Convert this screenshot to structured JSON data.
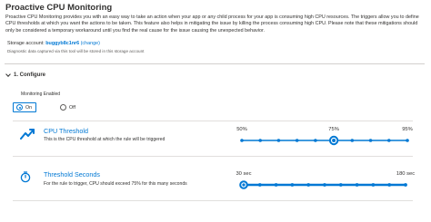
{
  "page": {
    "title": "Proactive CPU Monitoring",
    "description": "Proactive CPU Monitoring provides you with an easy way to take an action when your app or any child process for your app is consuming high CPU resources. The triggers allow you to define CPU thresholds at which you want the actions to be taken. This feature also helps in mitigating the issue by killing the process consuming high CPU. Please note that these mitigations should only be considered a temporary workaround until you find the real cause for the issue causing the unexpected behavior."
  },
  "storage": {
    "label": "Storage account:",
    "account": "buggyb8c1nr6",
    "change_link": "(change)",
    "note": "Diagnostic data captured via this tool will be stored in this storage account"
  },
  "configure": {
    "section_label": "1. Configure",
    "monitoring_label": "Monitoring Enabled",
    "options": [
      "On",
      "Off"
    ],
    "selected": "On"
  },
  "cpu_threshold": {
    "icon": "line-chart-icon",
    "title": "CPU Threshold",
    "subtitle": "This is the CPU threshold at which the rule will be triggered",
    "labels": [
      "50%",
      "75%",
      "95%"
    ],
    "label_values": [
      50,
      75,
      95
    ],
    "min": 50,
    "max": 95,
    "step": 5,
    "value": 75
  },
  "threshold_seconds": {
    "icon": "stopwatch-icon",
    "title": "Threshold Seconds",
    "subtitle": "For the rule to trigger, CPU should exceed 75% for this many seconds",
    "labels": [
      "30 sec",
      "180 sec"
    ],
    "label_values": [
      30,
      180
    ],
    "min": 30,
    "max": 180,
    "step": 15,
    "value": 30
  },
  "colors": {
    "accent": "#0078d4",
    "track": "#0078d4",
    "text": "#323130"
  }
}
